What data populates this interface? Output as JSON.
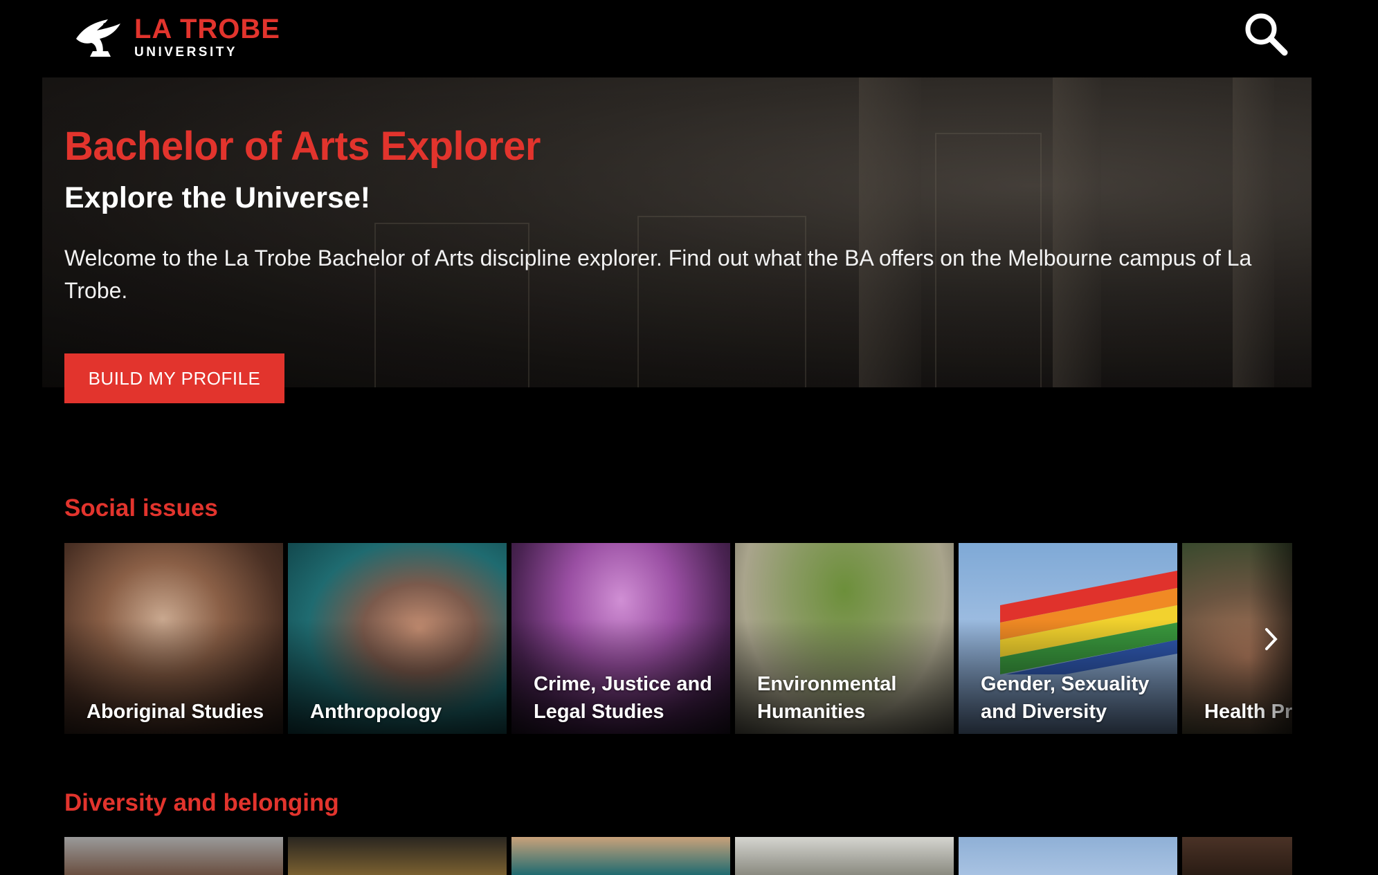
{
  "brand": {
    "line1": "LA TROBE",
    "line2": "UNIVERSITY",
    "accent": "#e2342d"
  },
  "header": {
    "search_icon": "search-icon"
  },
  "hero": {
    "title": "Bachelor of Arts Explorer",
    "subtitle": "Explore the Universe!",
    "description": "Welcome to the La Trobe Bachelor of Arts discipline explorer. Find out what the BA offers on the Melbourne campus of La Trobe.",
    "cta_label": "BUILD MY PROFILE"
  },
  "sections": [
    {
      "title": "Social issues",
      "tiles": [
        {
          "label": "Aboriginal Studies"
        },
        {
          "label": "Anthropology"
        },
        {
          "label": "Crime, Justice and\nLegal Studies"
        },
        {
          "label": "Environmental\nHumanities"
        },
        {
          "label": "Gender, Sexuality\nand Diversity"
        },
        {
          "label": "Health Pro"
        }
      ],
      "next_icon": "chevron-right-icon"
    },
    {
      "title": "Diversity and belonging"
    }
  ]
}
